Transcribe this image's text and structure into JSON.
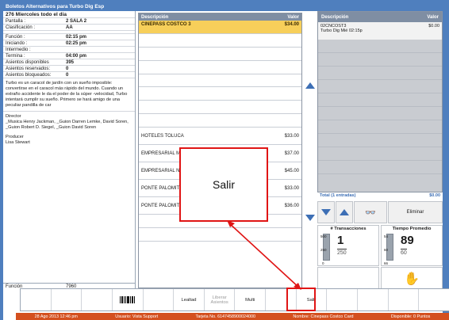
{
  "window": {
    "title": "Boletos Alternativos para  Turbo Dig Esp"
  },
  "show": {
    "heading": "276 Miercoles todo el dia",
    "rows": [
      {
        "label": "Pantalla :",
        "value": "2  SALA 2"
      },
      {
        "label": "Clasificación :",
        "value": "AA"
      },
      {
        "label": "Función :",
        "value": "02:15 pm"
      },
      {
        "label": "Iniciando :",
        "value": "02:25 pm"
      },
      {
        "label": "Intermedio :",
        "value": ""
      },
      {
        "label": "Termina :",
        "value": "04:00 pm"
      },
      {
        "label": "Asientos disponibles",
        "value": "395"
      },
      {
        "label": "Asientos reservados:",
        "value": "0"
      },
      {
        "label": "Asientos bloqueados:",
        "value": "0"
      }
    ],
    "synopsis": "Turbo es un caracol de jardín con un sueño imposible: convertirse en el caracol más rápido del mundo. Cuando un extraño accidente le da el poder de la súper -velocidad, Turbo intentará cumplir su sueño. Primero se hará amigo de una peculiar pandilla de car",
    "director_label": "Director",
    "director": "_Musica Henry Jackman, _Guion Darren Lemke, David Soren, _Guion Robert D. Siegel, _Guion David Soren",
    "producer_label": "Producer",
    "producer": "Lisa Stewart",
    "footer_label": "Función",
    "footer_value": "7960"
  },
  "tickets": {
    "col_desc": "Descripción",
    "col_value": "Valor",
    "selected": {
      "desc": "CINEPASS COSTCO 3",
      "value": "$34.00"
    },
    "items": [
      {
        "desc": "HOTELES TOLUCA",
        "value": "$33.00"
      },
      {
        "desc": "EMPRESARIAL MOR",
        "value": "$37.00"
      },
      {
        "desc": "EMPRESARIAL NAR",
        "value": "$45.00"
      },
      {
        "desc": "PONTE PALOMITA L",
        "value": "$33.00"
      },
      {
        "desc": "PONTE PALOMITA L-O CAFE",
        "value": "$36.00"
      }
    ]
  },
  "order": {
    "col_desc": "Descripción",
    "col_value": "Valor",
    "line_desc_1": "02CNCOST3",
    "line_desc_2": "Turbo Dig Mié 02:15p",
    "line_value": "$0.00",
    "total_label": "Total (1 entradas)",
    "total_value": "$0.00",
    "eliminar": "Eliminar",
    "icons": {
      "down": "arrow-down-icon",
      "up": "arrow-up-icon",
      "glasses": "3d-glasses-icon",
      "hand": "hand-icon"
    }
  },
  "counters": {
    "transacciones": {
      "title": "# Transacciones",
      "value": "1",
      "sub": "250",
      "ticks": [
        "500",
        "250",
        "0"
      ]
    },
    "tiempo": {
      "title": "Tiempo Promedio",
      "value": "89",
      "sub": "60",
      "ticks": [
        "54",
        "60",
        "66"
      ]
    }
  },
  "toolbar": {
    "lealtad": "Lealtad",
    "liberar": "Liberar Asientos",
    "multi": "Multi",
    "salir": "Salir"
  },
  "status": {
    "date": "28 Ago 2013 12:46 pm",
    "usuario": "Usuario: Vista Support",
    "tarjeta": "Tarjeta No. 6147458900024000",
    "nombre": "Nombre: Cinepass Costco Card",
    "puntos": "Disponible: 0 Puntos"
  },
  "callout": {
    "text": "Salir"
  },
  "colors": {
    "frame": "#4f7fbe",
    "selected_row": "#f7cf5a",
    "status_bar": "#d4501f",
    "highlight": "#e01515",
    "accent": "#3d6fb5"
  }
}
